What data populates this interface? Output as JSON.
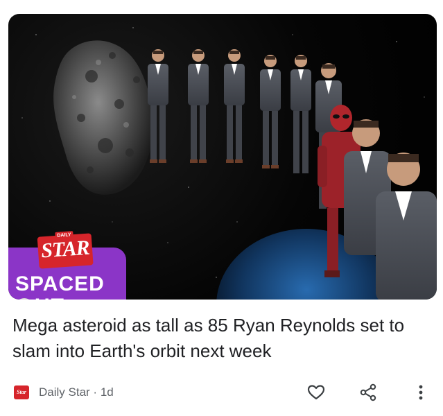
{
  "article": {
    "headline": "Mega asteroid as tall as 85 Ryan Reynolds set to slam into Earth's orbit next week",
    "image_badge": {
      "brand_small": "DAILY",
      "brand": "STAR",
      "line1": "SPACED",
      "line2": "UT"
    },
    "source": {
      "logo_text": "Star",
      "name": "Daily Star",
      "separator": "·",
      "age": "1d"
    }
  },
  "actions": {
    "like_icon": "heart-outline-icon",
    "share_icon": "share-icon",
    "more_icon": "more-vertical-icon"
  },
  "colors": {
    "badge_purple": "#8b35c7",
    "star_red": "#d6252b",
    "headline_text": "#202124",
    "meta_text": "#5f6368"
  }
}
